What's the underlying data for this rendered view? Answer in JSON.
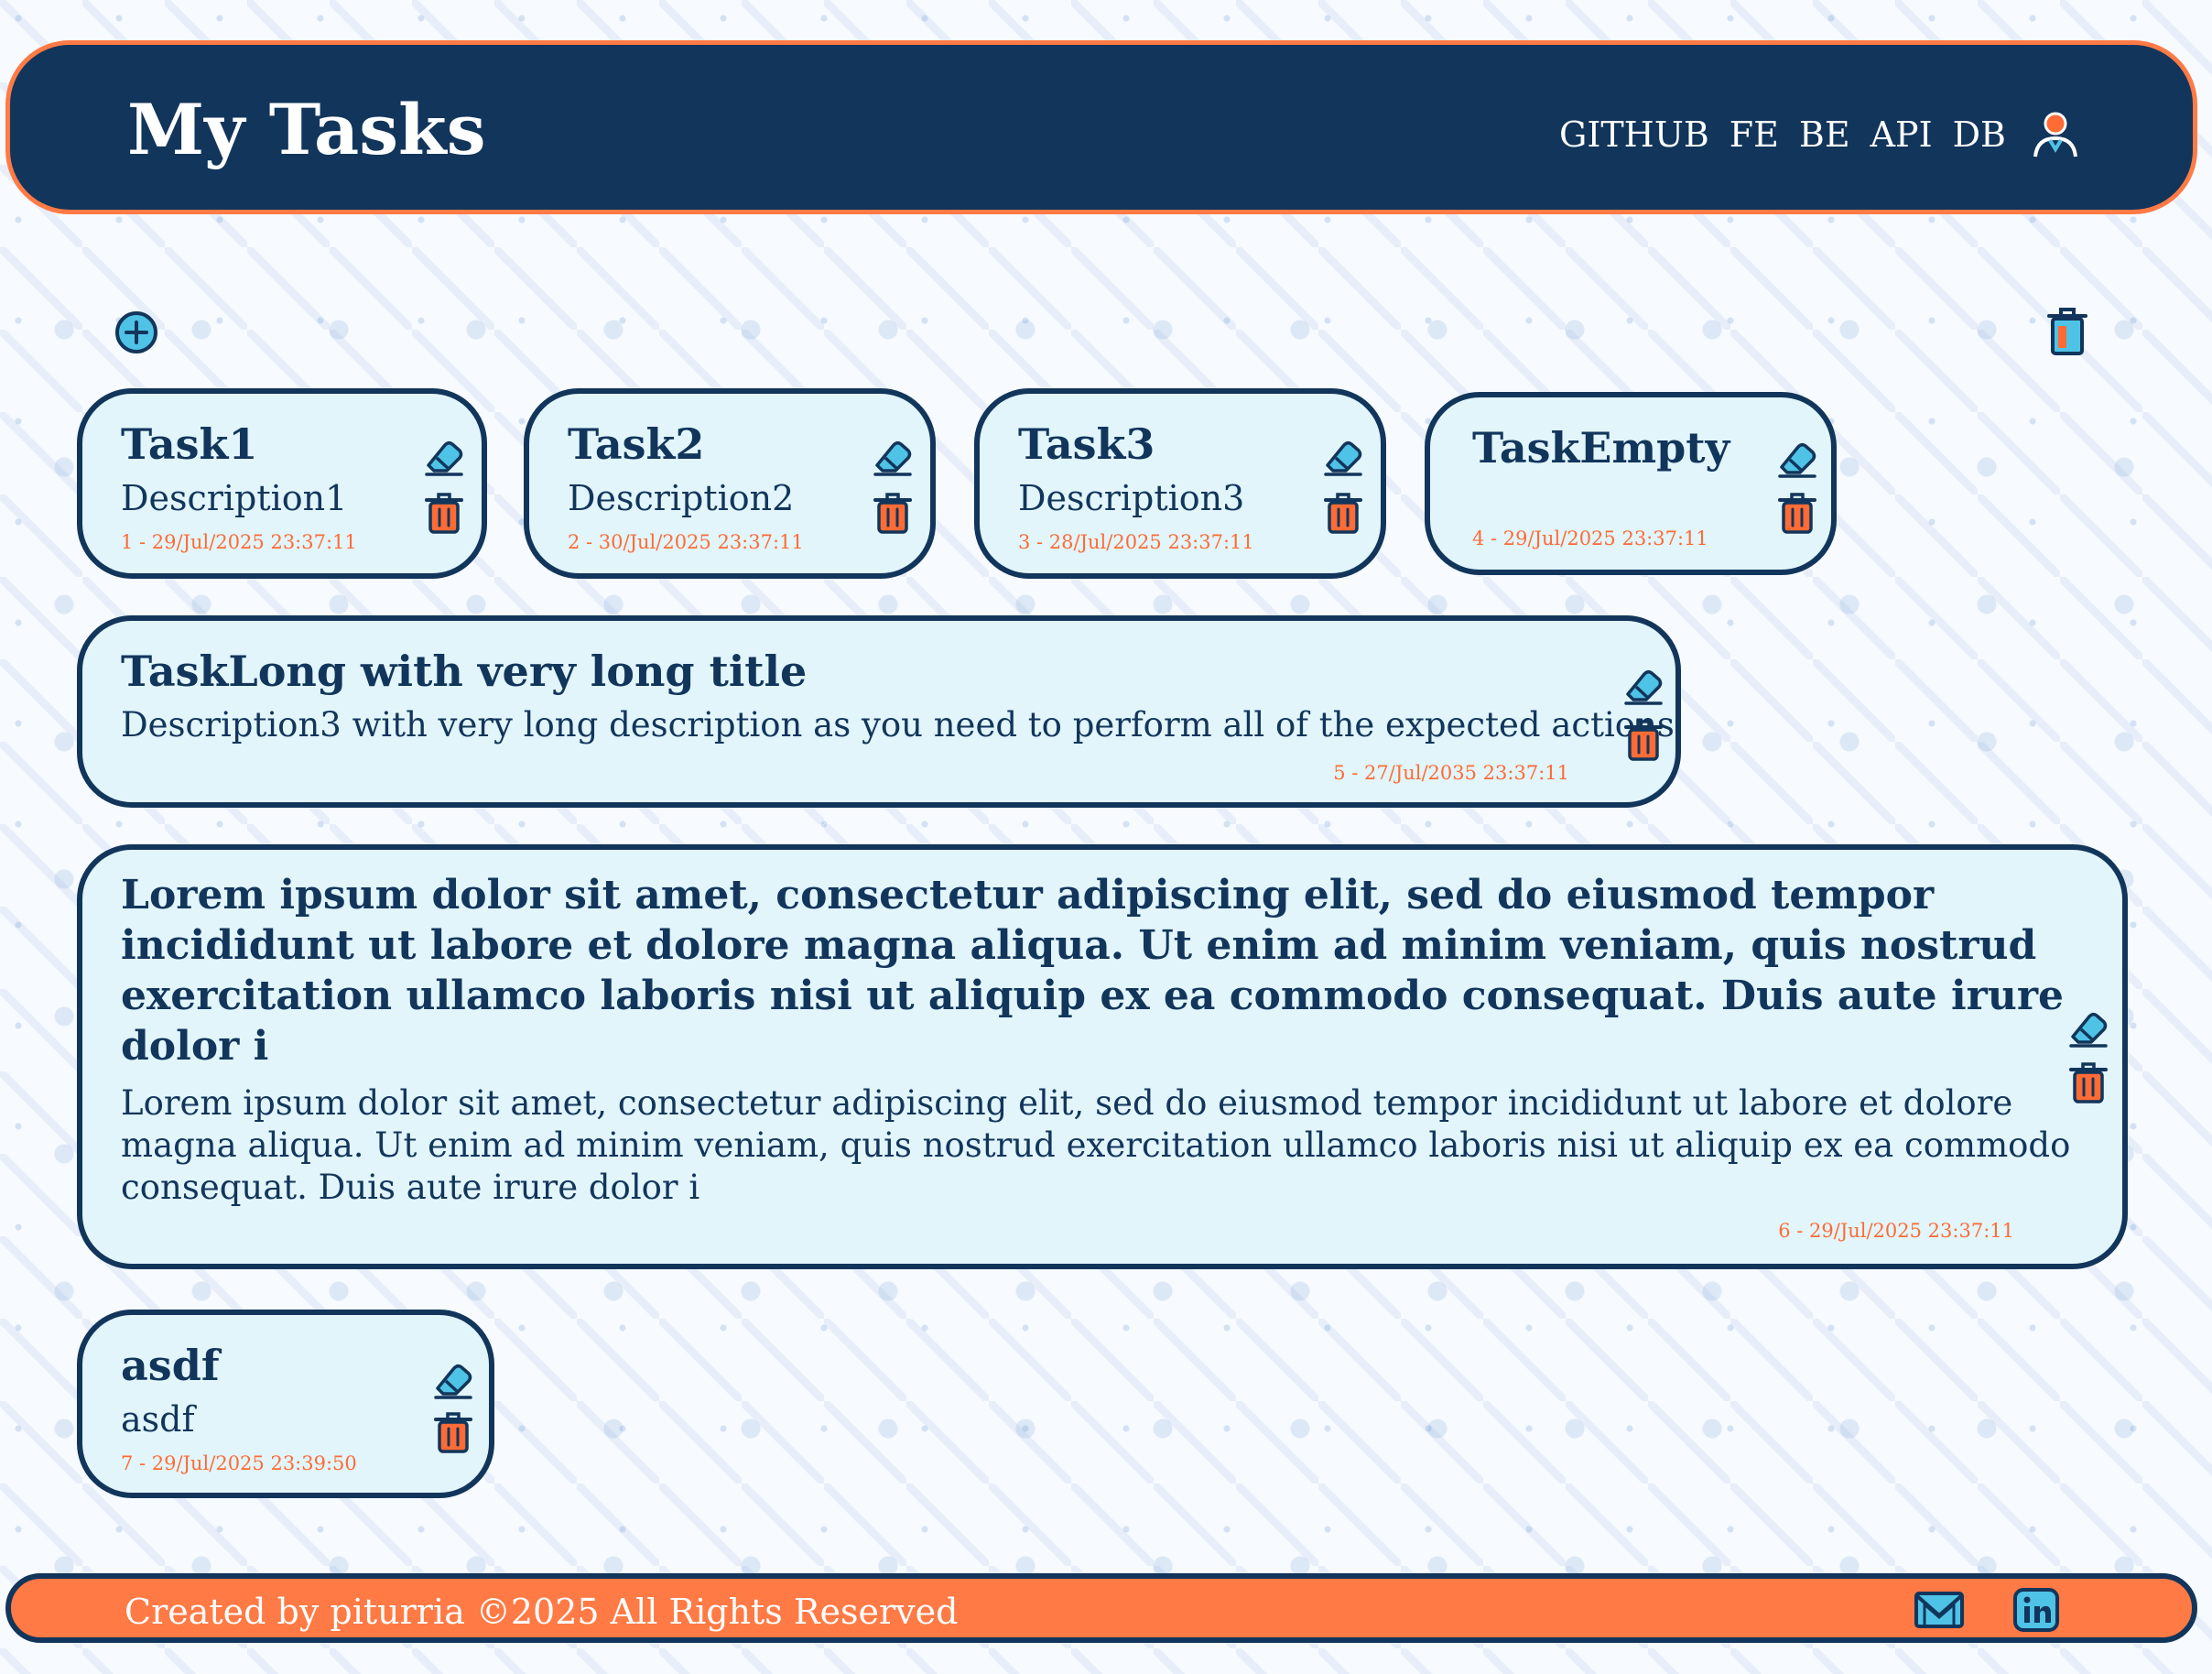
{
  "header": {
    "title": "My Tasks",
    "nav": [
      "GITHUB",
      "FE",
      "BE",
      "API",
      "DB"
    ],
    "user_icon": "user-avatar-icon"
  },
  "toolbar": {
    "add_icon": "plus-circle-icon",
    "clear_icon": "trash-icon"
  },
  "tasks": [
    {
      "title": "Task1",
      "description": "Description1",
      "meta": "1 - 29/Jul/2025 23:37:11"
    },
    {
      "title": "Task2",
      "description": "Description2",
      "meta": "2 - 30/Jul/2025 23:37:11"
    },
    {
      "title": "Task3",
      "description": "Description3",
      "meta": "3 - 28/Jul/2025 23:37:11"
    },
    {
      "title": "TaskEmpty",
      "description": "",
      "meta": "4 - 29/Jul/2025 23:37:11"
    },
    {
      "title": "TaskLong with very long title",
      "description": "Description3 with very long description as you need to perform all of the expected actions",
      "meta": "5 - 27/Jul/2035 23:37:11"
    },
    {
      "title": "Lorem ipsum dolor sit amet, consectetur adipiscing elit, sed do eiusmod tempor incididunt ut labore et dolore magna aliqua. Ut enim ad minim veniam, quis nostrud exercitation ullamco laboris nisi ut aliquip ex ea commodo consequat. Duis aute irure dolor i",
      "description": "Lorem ipsum dolor sit amet, consectetur adipiscing elit, sed do eiusmod tempor incididunt ut labore et dolore magna aliqua. Ut enim ad minim veniam, quis nostrud exercitation ullamco laboris nisi ut aliquip ex ea commodo consequat. Duis aute irure dolor i",
      "meta": "6 - 29/Jul/2025 23:37:11"
    },
    {
      "title": "asdf",
      "description": "asdf",
      "meta": "7 - 29/Jul/2025 23:39:50"
    }
  ],
  "card_icons": {
    "edit": "eraser-icon",
    "delete": "trash-icon"
  },
  "footer": {
    "text": "Created by piturria ©2025 All Rights Reserved",
    "mail_icon": "mail-icon",
    "linkedin_icon": "linkedin-icon"
  },
  "colors": {
    "navy": "#12355b",
    "orange": "#ff7a45",
    "card_bg": "#e1f5fb",
    "accent_cyan": "#4fc3e6",
    "meta_text": "#ff6b35"
  }
}
